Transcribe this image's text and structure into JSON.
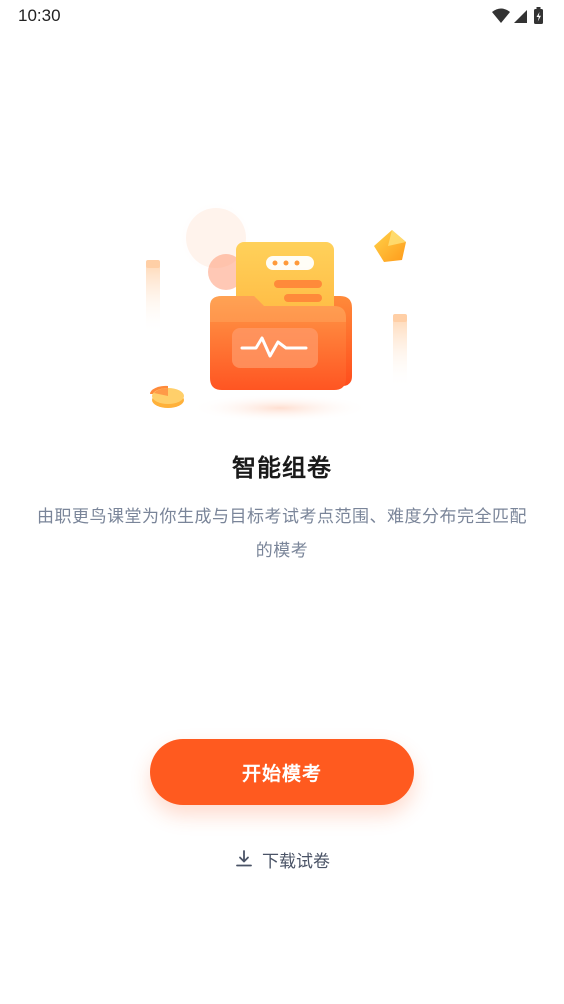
{
  "status_bar": {
    "time": "10:30",
    "icons": [
      "wifi-icon",
      "signal-icon",
      "battery-charging-icon"
    ]
  },
  "main": {
    "title": "智能组卷",
    "description": "由职更鸟课堂为你生成与目标考试考点范围、难度分布完全匹配的模考"
  },
  "actions": {
    "start_label": "开始模考",
    "download_label": "下载试卷"
  },
  "colors": {
    "accent": "#ff5a1f",
    "title": "#1a1a1a",
    "description": "#7a8599",
    "link": "#4a5366"
  }
}
